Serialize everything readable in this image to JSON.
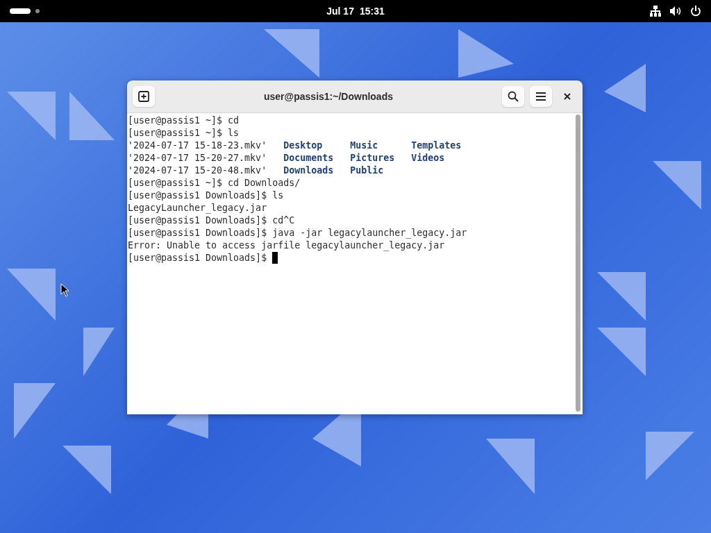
{
  "top_bar": {
    "date": "Jul 17",
    "time": "15:31"
  },
  "window": {
    "title": "user@passis1:~/Downloads"
  },
  "terminal": {
    "lines": [
      {
        "kind": "text",
        "text": "[user@passis1 ~]$ cd"
      },
      {
        "kind": "text",
        "text": "[user@passis1 ~]$ ls"
      },
      {
        "kind": "listing",
        "cells": [
          {
            "kind": "file",
            "text": "'2024-07-17 15-18-23.mkv'"
          },
          {
            "kind": "dir",
            "text": "Desktop"
          },
          {
            "kind": "dir",
            "text": "Music"
          },
          {
            "kind": "dir",
            "text": "Templates"
          }
        ]
      },
      {
        "kind": "listing",
        "cells": [
          {
            "kind": "file",
            "text": "'2024-07-17 15-20-27.mkv'"
          },
          {
            "kind": "dir",
            "text": "Documents"
          },
          {
            "kind": "dir",
            "text": "Pictures"
          },
          {
            "kind": "dir",
            "text": "Videos"
          }
        ]
      },
      {
        "kind": "listing",
        "cells": [
          {
            "kind": "file",
            "text": "'2024-07-17 15-20-48.mkv'"
          },
          {
            "kind": "dir",
            "text": "Downloads"
          },
          {
            "kind": "dir",
            "text": "Public"
          }
        ]
      },
      {
        "kind": "text",
        "text": "[user@passis1 ~]$ cd Downloads/"
      },
      {
        "kind": "text",
        "text": "[user@passis1 Downloads]$ ls"
      },
      {
        "kind": "text",
        "text": "LegacyLauncher_legacy.jar"
      },
      {
        "kind": "text",
        "text": "[user@passis1 Downloads]$ cd^C"
      },
      {
        "kind": "text",
        "text": "[user@passis1 Downloads]$ java -jar legacylauncher_legacy.jar"
      },
      {
        "kind": "text",
        "text": "Error: Unable to access jarfile legacylauncher_legacy.jar"
      },
      {
        "kind": "prompt",
        "text": "[user@passis1 Downloads]$"
      }
    ]
  }
}
